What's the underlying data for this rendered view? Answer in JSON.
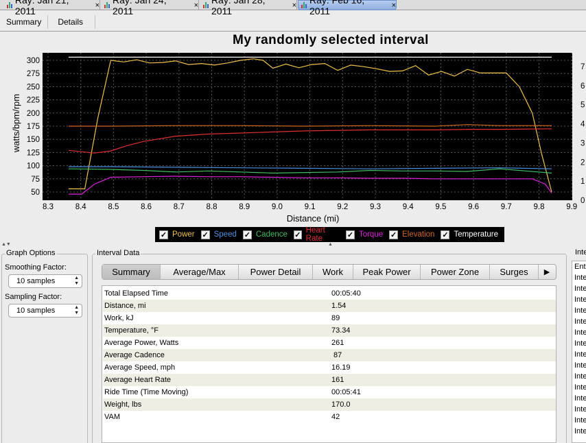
{
  "doc_tabs": [
    {
      "label": "Ray: Jan 21, 2011",
      "active": false
    },
    {
      "label": "Ray: Jan 24, 2011",
      "active": false
    },
    {
      "label": "Ray: Jan 28, 2011",
      "active": false
    },
    {
      "label": "Ray: Feb 16, 2011",
      "active": true
    }
  ],
  "close_glyph": "×",
  "view_tabs": [
    "Summary",
    "Details"
  ],
  "chart_data": {
    "type": "line",
    "title": "My randomly selected interval",
    "xlabel": "Distance (mi)",
    "ylabel": "watts/bpm/rpm",
    "xlim": [
      8.3,
      9.9
    ],
    "ylim": [
      40,
      310
    ],
    "y2lim": [
      0,
      7.6
    ],
    "x_ticks": [
      "8.3",
      "8.4",
      "8.5",
      "8.6",
      "8.7",
      "8.8",
      "8.9",
      "9.0",
      "9.1",
      "9.2",
      "9.3",
      "9.4",
      "9.5",
      "9.6",
      "9.7",
      "9.8",
      "9.9"
    ],
    "y_ticks": [
      "50",
      "75",
      "100",
      "125",
      "150",
      "175",
      "200",
      "225",
      "250",
      "275",
      "300"
    ],
    "y2_ticks": [
      "0",
      "1",
      "2",
      "3",
      "4",
      "5",
      "6",
      "7"
    ],
    "grid": true,
    "background": "#000000",
    "series": [
      {
        "name": "Power",
        "color": "#f2c14a",
        "axis": "left",
        "x": [
          8.37,
          8.42,
          8.46,
          8.5,
          8.54,
          8.58,
          8.62,
          8.66,
          8.7,
          8.74,
          8.78,
          8.82,
          8.86,
          8.9,
          8.94,
          8.97,
          9.0,
          9.04,
          9.08,
          9.12,
          9.16,
          9.2,
          9.24,
          9.28,
          9.32,
          9.36,
          9.4,
          9.44,
          9.48,
          9.52,
          9.56,
          9.6,
          9.64,
          9.68,
          9.72,
          9.76,
          9.8,
          9.83,
          9.86
        ],
        "y": [
          56,
          56,
          190,
          300,
          297,
          301,
          295,
          296,
          299,
          292,
          294,
          291,
          295,
          300,
          303,
          300,
          285,
          293,
          286,
          292,
          294,
          281,
          291,
          288,
          284,
          279,
          280,
          290,
          272,
          279,
          270,
          283,
          276,
          276,
          276,
          250,
          200,
          120,
          50
        ]
      },
      {
        "name": "Speed",
        "color": "#4a90e2",
        "axis": "left",
        "x": [
          8.37,
          8.5,
          8.7,
          8.9,
          9.1,
          9.3,
          9.5,
          9.7,
          9.86
        ],
        "y": [
          98,
          98,
          97,
          96,
          95,
          94,
          95,
          96,
          94
        ]
      },
      {
        "name": "Cadence",
        "color": "#3fbf5f",
        "axis": "left",
        "x": [
          8.37,
          8.5,
          8.6,
          8.7,
          8.8,
          8.9,
          9.0,
          9.1,
          9.2,
          9.3,
          9.4,
          9.5,
          9.6,
          9.7,
          9.86
        ],
        "y": [
          94,
          93,
          91,
          88,
          90,
          88,
          86,
          87,
          88,
          91,
          90,
          90,
          89,
          94,
          86
        ]
      },
      {
        "name": "Heart Rate",
        "color": "#e03030",
        "axis": "left",
        "x": [
          8.37,
          8.45,
          8.5,
          8.55,
          8.6,
          8.7,
          8.8,
          8.9,
          9.0,
          9.1,
          9.2,
          9.3,
          9.4,
          9.5,
          9.6,
          9.7,
          9.86
        ],
        "y": [
          129,
          124,
          128,
          138,
          146,
          156,
          160,
          162,
          164,
          166,
          167,
          168,
          168,
          168,
          169,
          169,
          170
        ]
      },
      {
        "name": "Torque",
        "color": "#e020e0",
        "axis": "left",
        "x": [
          8.37,
          8.41,
          8.45,
          8.5,
          8.6,
          8.7,
          8.8,
          8.9,
          9.0,
          9.1,
          9.2,
          9.3,
          9.4,
          9.5,
          9.6,
          9.7,
          9.8,
          9.84,
          9.86
        ],
        "y": [
          46,
          46,
          65,
          78,
          79,
          80,
          79,
          79,
          78,
          77,
          77,
          76,
          76,
          75,
          75,
          75,
          75,
          65,
          48
        ]
      },
      {
        "name": "Elevation",
        "color": "#d2691e",
        "axis": "left",
        "x": [
          8.37,
          8.5,
          8.7,
          8.9,
          9.1,
          9.3,
          9.5,
          9.6,
          9.7,
          9.86
        ],
        "y": [
          175,
          175,
          176,
          176,
          175,
          176,
          175,
          178,
          176,
          176
        ]
      },
      {
        "name": "Temperature",
        "color": "#ffffff",
        "axis": "left",
        "x": [
          8.37,
          9.86
        ],
        "y": [
          306,
          306
        ]
      }
    ]
  },
  "legend_check": "✓",
  "graph_options": {
    "title": "Graph Options",
    "smoothing_label": "Smoothing Factor:",
    "smoothing_value": "10 samples",
    "sampling_label": "Sampling Factor:",
    "sampling_value": "10 samples",
    "spinner_glyph": "▲\n▼"
  },
  "interval_data": {
    "title": "Interval Data",
    "tabs": [
      "Summary",
      "Average/Max",
      "Power Detail",
      "Work",
      "Peak Power",
      "Power Zone",
      "Surges"
    ],
    "more_glyph": "▶",
    "rows": [
      {
        "label": "Total Elapsed Time",
        "value": "00:05:40"
      },
      {
        "label": "Distance, mi",
        "value": "1.54"
      },
      {
        "label": "Work, kJ",
        "value": "89"
      },
      {
        "label": "Temperature, °F",
        "value": "73.34"
      },
      {
        "label": "Average Power, Watts",
        "value": "261"
      },
      {
        "label": "Average Cadence",
        "value": " 87"
      },
      {
        "label": "Average Speed, mph",
        "value": "16.19"
      },
      {
        "label": "Average Heart Rate",
        "value": "161"
      },
      {
        "label": "Ride Time (Time Moving)",
        "value": "00:05:41"
      },
      {
        "label": "Weight, lbs",
        "value": "170.0"
      },
      {
        "label": "VAM",
        "value": "42"
      }
    ]
  },
  "right_panel": {
    "title": "Inte",
    "items": [
      "Ent",
      "Inte",
      "Inte",
      "Inte",
      "Inte",
      "Inte",
      "Inte",
      "Inte",
      "Inte",
      "Inte",
      "Inte",
      "Inte",
      "Inte",
      "Inte",
      "Inte",
      "Inte"
    ]
  }
}
